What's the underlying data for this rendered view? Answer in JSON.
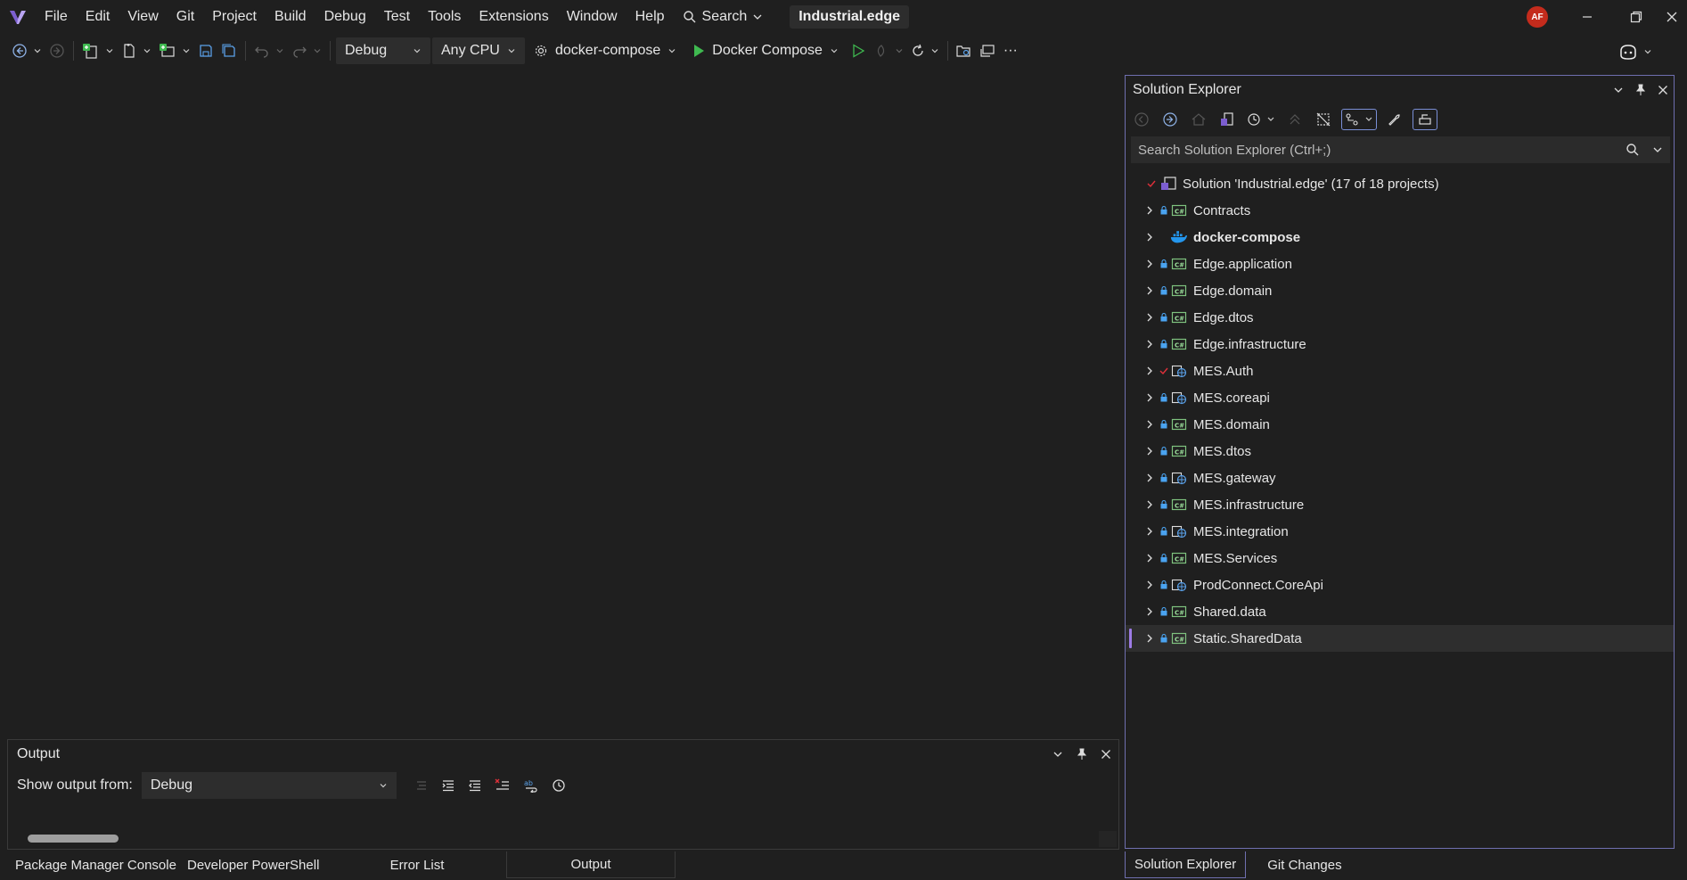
{
  "menubar": {
    "items": [
      "File",
      "Edit",
      "View",
      "Git",
      "Project",
      "Build",
      "Debug",
      "Test",
      "Tools",
      "Extensions",
      "Window",
      "Help"
    ],
    "search_label": "Search",
    "solution_name": "Industrial.edge",
    "avatar_initials": "AF"
  },
  "toolbar": {
    "configuration": "Debug",
    "platform": "Any CPU",
    "startup_project": "docker-compose",
    "run_target": "Docker Compose",
    "more": "···"
  },
  "solution_explorer": {
    "title": "Solution Explorer",
    "search_placeholder": "Search Solution Explorer (Ctrl+;)",
    "root": "Solution 'Industrial.edge' (17 of 18 projects)",
    "projects": [
      {
        "name": "Contracts",
        "icon": "csharp-project-icon",
        "status": "lock"
      },
      {
        "name": "docker-compose",
        "icon": "docker-icon",
        "status": "none",
        "bold": true
      },
      {
        "name": "Edge.application",
        "icon": "csharp-project-icon",
        "status": "lock"
      },
      {
        "name": "Edge.domain",
        "icon": "csharp-project-icon",
        "status": "lock"
      },
      {
        "name": "Edge.dtos",
        "icon": "csharp-project-icon",
        "status": "lock"
      },
      {
        "name": "Edge.infrastructure",
        "icon": "csharp-project-icon",
        "status": "lock"
      },
      {
        "name": "MES.Auth",
        "icon": "web-project-icon",
        "status": "check"
      },
      {
        "name": "MES.coreapi",
        "icon": "web-project-icon",
        "status": "lock"
      },
      {
        "name": "MES.domain",
        "icon": "csharp-project-icon",
        "status": "lock"
      },
      {
        "name": "MES.dtos",
        "icon": "csharp-project-icon",
        "status": "lock"
      },
      {
        "name": "MES.gateway",
        "icon": "web-project-icon",
        "status": "lock"
      },
      {
        "name": "MES.infrastructure",
        "icon": "csharp-project-icon",
        "status": "lock"
      },
      {
        "name": "MES.integration",
        "icon": "web-project-icon",
        "status": "lock"
      },
      {
        "name": "MES.Services",
        "icon": "csharp-project-icon",
        "status": "lock"
      },
      {
        "name": "ProdConnect.CoreApi",
        "icon": "web-project-icon",
        "status": "lock"
      },
      {
        "name": "Shared.data",
        "icon": "csharp-project-icon",
        "status": "lock"
      },
      {
        "name": "Static.SharedData",
        "icon": "csharp-project-icon",
        "status": "lock",
        "selected": true
      }
    ],
    "tabs": [
      "Solution Explorer",
      "Git Changes"
    ]
  },
  "output": {
    "title": "Output",
    "show_from_label": "Show output from:",
    "source": "Debug",
    "tabs": [
      "Package Manager Console",
      "Developer PowerShell",
      "Error List",
      "Output"
    ]
  },
  "colors": {
    "background": "#1f1f1f",
    "accent": "#9d7be6",
    "run_green": "#3fb950",
    "avatar": "#c42b1c",
    "lock_blue": "#4aa3f0"
  }
}
